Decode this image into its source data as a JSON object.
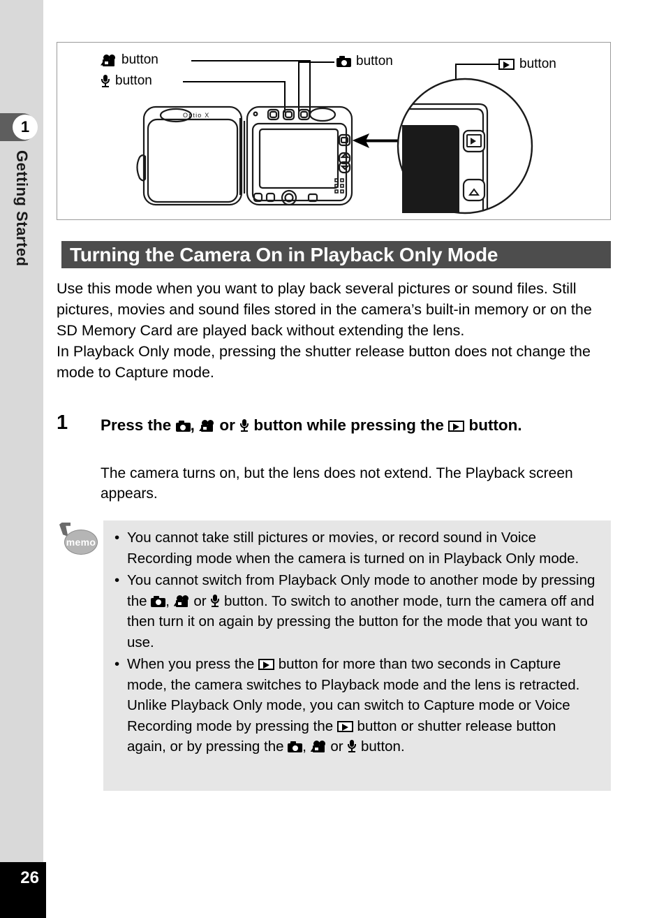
{
  "sidebar": {
    "chapter_number": "1",
    "chapter_title": "Getting Started",
    "page_number": "26"
  },
  "figure": {
    "callouts": [
      {
        "icon": "movie-camera-icon",
        "label": "button"
      },
      {
        "icon": "microphone-icon",
        "label": "button"
      },
      {
        "icon": "camera-icon",
        "label": "button"
      },
      {
        "icon": "playback-icon",
        "label": "button"
      }
    ],
    "camera_model": "Optio X"
  },
  "section": {
    "heading": "Turning the Camera On in Playback Only Mode"
  },
  "intro": {
    "paragraph_1": "Use this mode when you want to play back several pictures or sound files. Still pictures, movies and sound files stored in the camera’s built-in memory or on the SD Memory Card are played back without extending the lens.",
    "paragraph_2": "In Playback Only mode, pressing the shutter release button does not change the mode to Capture mode."
  },
  "step": {
    "number": "1",
    "title_part_1": "Press the",
    "title_part_2": ",",
    "title_part_3": "or",
    "title_part_4": "button while pressing the",
    "title_part_5": "button.",
    "description": "The camera turns on, but the lens does not extend. The Playback screen appears."
  },
  "memo": {
    "icon_label": "memo",
    "bullet": "•",
    "items": [
      {
        "text_1": "You cannot take still pictures or movies, or record sound in Voice Recording mode when the camera is turned on in Playback Only mode."
      },
      {
        "text_1": "You cannot switch from Playback Only mode to another mode by pressing the",
        "text_2": ",",
        "text_3": "or",
        "text_4": "button. To switch to another mode, turn the camera off and then turn it on again by pressing the button for the mode that you want to use."
      },
      {
        "text_1": "When you press the",
        "text_2": "button for more than two seconds in Capture mode, the camera switches to Playback mode and the lens is retracted. Unlike Playback Only mode, you can switch to Capture mode or Voice Recording mode by pressing the",
        "text_3": "button or shutter release button again, or by pressing the",
        "text_4": ",",
        "text_5": "or",
        "text_6": "button."
      }
    ]
  },
  "colors": {
    "sidebar_bg": "#d9d9d9",
    "chapter_tab": "#5e5e5e",
    "heading_bg": "#4d4d4d",
    "memo_bg": "#e6e6e6",
    "page_block": "#000000"
  }
}
